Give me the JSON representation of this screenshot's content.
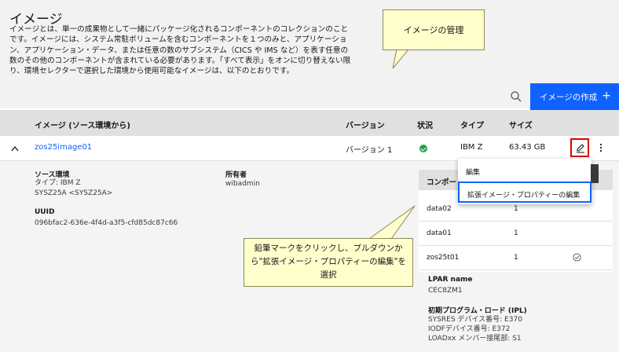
{
  "header": {
    "title": "イメージ",
    "description": "イメージとは、単一の成果物として一緒にパッケージ化されるコンポーネントのコレクションのことです。イメージには、システム常駐ボリュームを含むコンポーネントを１つのみと、アプリケーション、アプリケーション・データ、または任意の数のサブシステム（CICS や IMS など）を表す任意の数のその他のコンポーネントが含まれている必要があります。「すべて表示」をオンに切り替えない限り、環境セレクターで選択した環境から使用可能なイメージは、以下のとおりです。",
    "create_label": "イメージの作成",
    "create_plus": "+"
  },
  "table": {
    "columns": [
      "イメージ (ソース環境から)",
      "バージョン",
      "状況",
      "タイプ",
      "サイズ"
    ],
    "row": {
      "name": "zos25image01",
      "version": "バージョン 1",
      "type": "IBM Z",
      "size": "63.43 GB"
    }
  },
  "detail": {
    "source_env_label": "ソース環境",
    "source_type": "タイプ: IBM Z",
    "source_name": "SYSZ25A <SYSZ25A>",
    "uuid_label": "UUID",
    "uuid": "096bfac2-636e-4f4d-a3f5-cfd85dc87c66",
    "owner_label": "所有者",
    "owner": "wibadmin",
    "components_header": "コンポー",
    "components": [
      {
        "name": "data02",
        "count": "1"
      },
      {
        "name": "data01",
        "count": "1"
      },
      {
        "name": "zos25t01",
        "count": "1"
      }
    ],
    "lpar_label": "LPAR name",
    "lpar": "CEC8ZM1",
    "ipl_label": "初期プログラム・ロード (IPL)",
    "ipl_lines": [
      "SYSRES デバイス番号: E370",
      "IODFデバイス番号: E372",
      "LOADxx メンバー接尾部: S1"
    ]
  },
  "menu": {
    "items": [
      "編集",
      "拡張イメージ・プロパティーの編集"
    ]
  },
  "callouts": {
    "top": "イメージの管理",
    "bottom": "鉛筆マークをクリックし、プルダウンから\"拡張イメージ・プロパティーの編集\"を選択"
  },
  "colors": {
    "accent": "#0f62fe",
    "status_ok": "#24a148",
    "highlight_red": "#e00000",
    "callout_bg": "#ffffcc"
  }
}
